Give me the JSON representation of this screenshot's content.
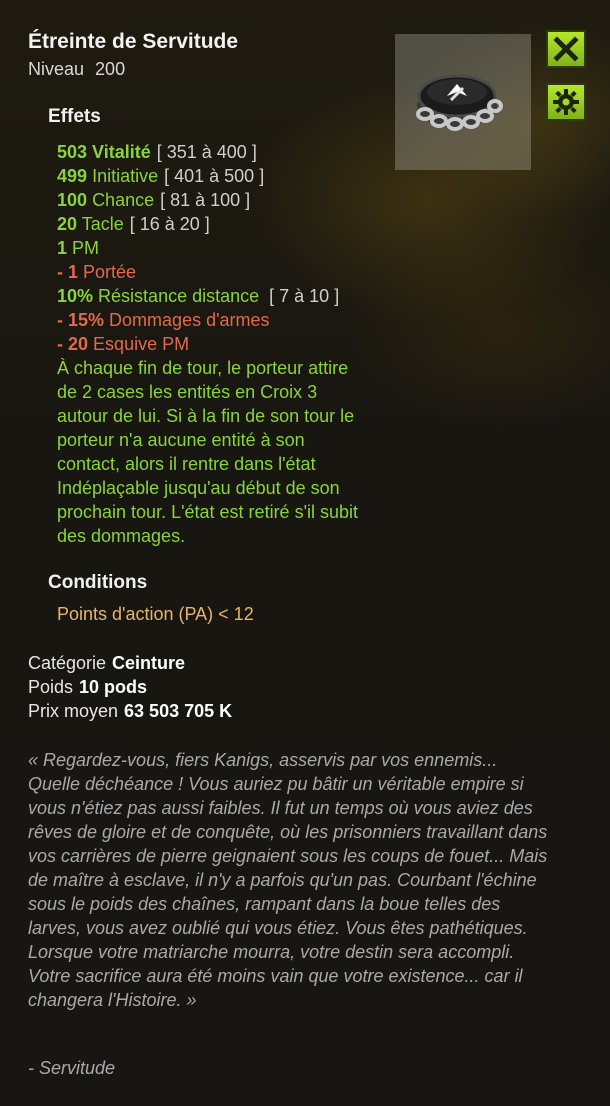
{
  "item": {
    "name": "Étreinte de Servitude",
    "level_label": "Niveau",
    "level_value": "200",
    "icon": "belt-chain-icon"
  },
  "buttons": {
    "close_icon": "close-icon",
    "settings_icon": "gear-icon"
  },
  "effects": {
    "heading": "Effets",
    "lines": [
      {
        "value": "503 Vitalité",
        "range": "[ 351 à 400 ]",
        "color": "#8bd33a"
      },
      {
        "value_num": "499",
        "value_label": "Initiative",
        "range": "[ 401 à 500 ]"
      },
      {
        "value_num": "100",
        "value_label": "Chance",
        "range": "[ 81 à 100 ]"
      },
      {
        "value_num": "20",
        "value_label": "Tacle",
        "range": "[ 16 à 20 ]"
      },
      {
        "value_num": "1",
        "value_label": "PM"
      },
      {
        "value_num": "- 1",
        "value_label": "Portée",
        "color": "#e06a4e"
      },
      {
        "value_num": "10%",
        "value_label": "Résistance distance",
        "range": "[ 7 à 10 ]"
      },
      {
        "value_num": "- 15%",
        "value_label": "Dommages d'armes",
        "color": "#e06a4e"
      },
      {
        "value_num": "- 20",
        "value_label": "Esquive PM",
        "color": "#e06a4e"
      }
    ],
    "description": "À chaque fin de tour, le porteur attire de 2 cases les entités en Croix 3 autour de lui. Si à la fin de son tour le porteur n'a aucune entité à son contact, alors il rentre dans l'état Indéplaçable jusqu'au début de son prochain tour. L'état est retiré s'il subit des dommages."
  },
  "conditions": {
    "heading": "Conditions",
    "text": "Points d'action (PA) < 12"
  },
  "meta": {
    "category_label": "Catégorie",
    "category_value": "Ceinture",
    "weight_label": "Poids",
    "weight_value": "10 pods",
    "price_label": "Prix moyen",
    "price_value": "63 503 705 K"
  },
  "lore": {
    "text": "« Regardez-vous, fiers Kanigs, asservis par vos ennemis... Quelle déchéance ! Vous auriez pu bâtir un véritable empire si vous n'étiez pas aussi faibles. Il fut un temps où vous aviez des rêves de gloire et de conquête, où les prisonniers travaillant dans vos carrières de pierre geignaient sous les coups de fouet... Mais de maître à esclave, il n'y a parfois qu'un pas. Courbant l'échine sous le poids des chaînes, rampant dans la boue telles des larves, vous avez oublié qui vous étiez. Vous êtes pathétiques. Lorsque votre matriarche mourra, votre destin sera accompli. Votre sacrifice aura été moins vain que votre existence... car il changera l'Histoire. »",
    "signature": "- Servitude"
  }
}
